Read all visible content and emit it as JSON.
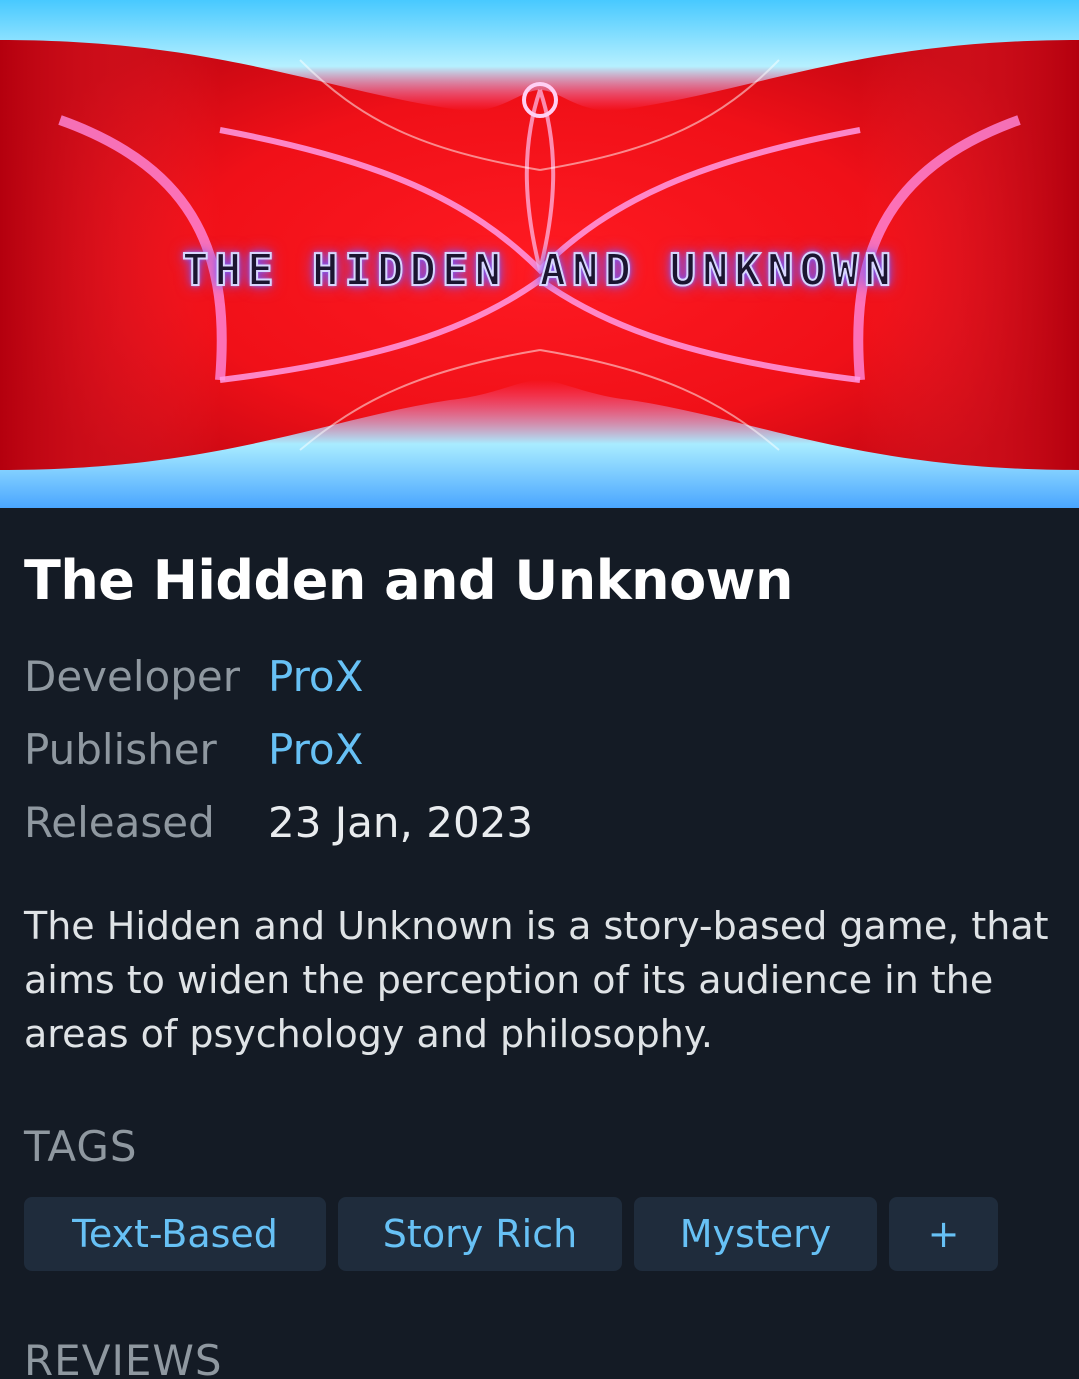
{
  "header": {
    "image_alt": "The Hidden and Unknown header art",
    "logo_text": "THE HIDDEN AND UNKNOWN"
  },
  "game": {
    "title": "The Hidden and Unknown",
    "developer_label": "Developer",
    "developer": "ProX",
    "publisher_label": "Publisher",
    "publisher": "ProX",
    "released_label": "Released",
    "released": "23 Jan, 2023",
    "description": "The Hidden and Unknown is a story-based game, that aims to widen the perception of its audience in the areas of psychology and philosophy."
  },
  "tags": {
    "heading": "TAGS",
    "items": [
      "Text-Based",
      "Story Rich",
      "Mystery"
    ],
    "more_label": "+"
  },
  "reviews": {
    "heading": "REVIEWS"
  },
  "colors": {
    "background": "#141b25",
    "link": "#67c1f5",
    "label": "#8f98a0",
    "tag_background": "#1f2c3c"
  }
}
